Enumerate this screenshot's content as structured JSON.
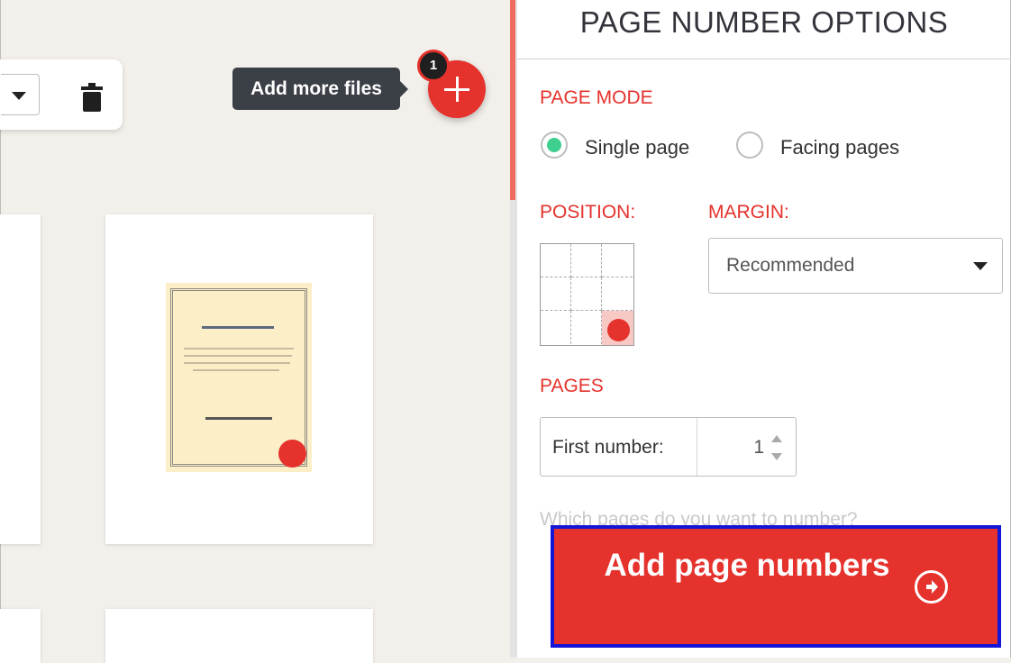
{
  "workspace": {
    "tooltip": "Add more files",
    "file_count_badge": "1"
  },
  "panel": {
    "title": "PAGE NUMBER OPTIONS",
    "page_mode": {
      "label": "PAGE MODE",
      "options": [
        {
          "label": "Single page",
          "selected": true
        },
        {
          "label": "Facing pages",
          "selected": false
        }
      ]
    },
    "position": {
      "label": "POSITION:",
      "selected_cell": "bottom-right"
    },
    "margin": {
      "label": "MARGIN:",
      "value": "Recommended"
    },
    "pages": {
      "label": "PAGES",
      "first_number_label": "First number:",
      "first_number_value": "1",
      "question": "Which pages do you want to number?"
    },
    "action_button": {
      "label": "Add page numbers"
    }
  },
  "colors": {
    "accent_red": "#e5322d",
    "selected_radio": "#3fcf8e",
    "highlight_border": "#1515d6"
  },
  "icons": [
    "trash-icon",
    "plus-icon",
    "caret-down-icon",
    "arrow-right-circle-icon"
  ]
}
